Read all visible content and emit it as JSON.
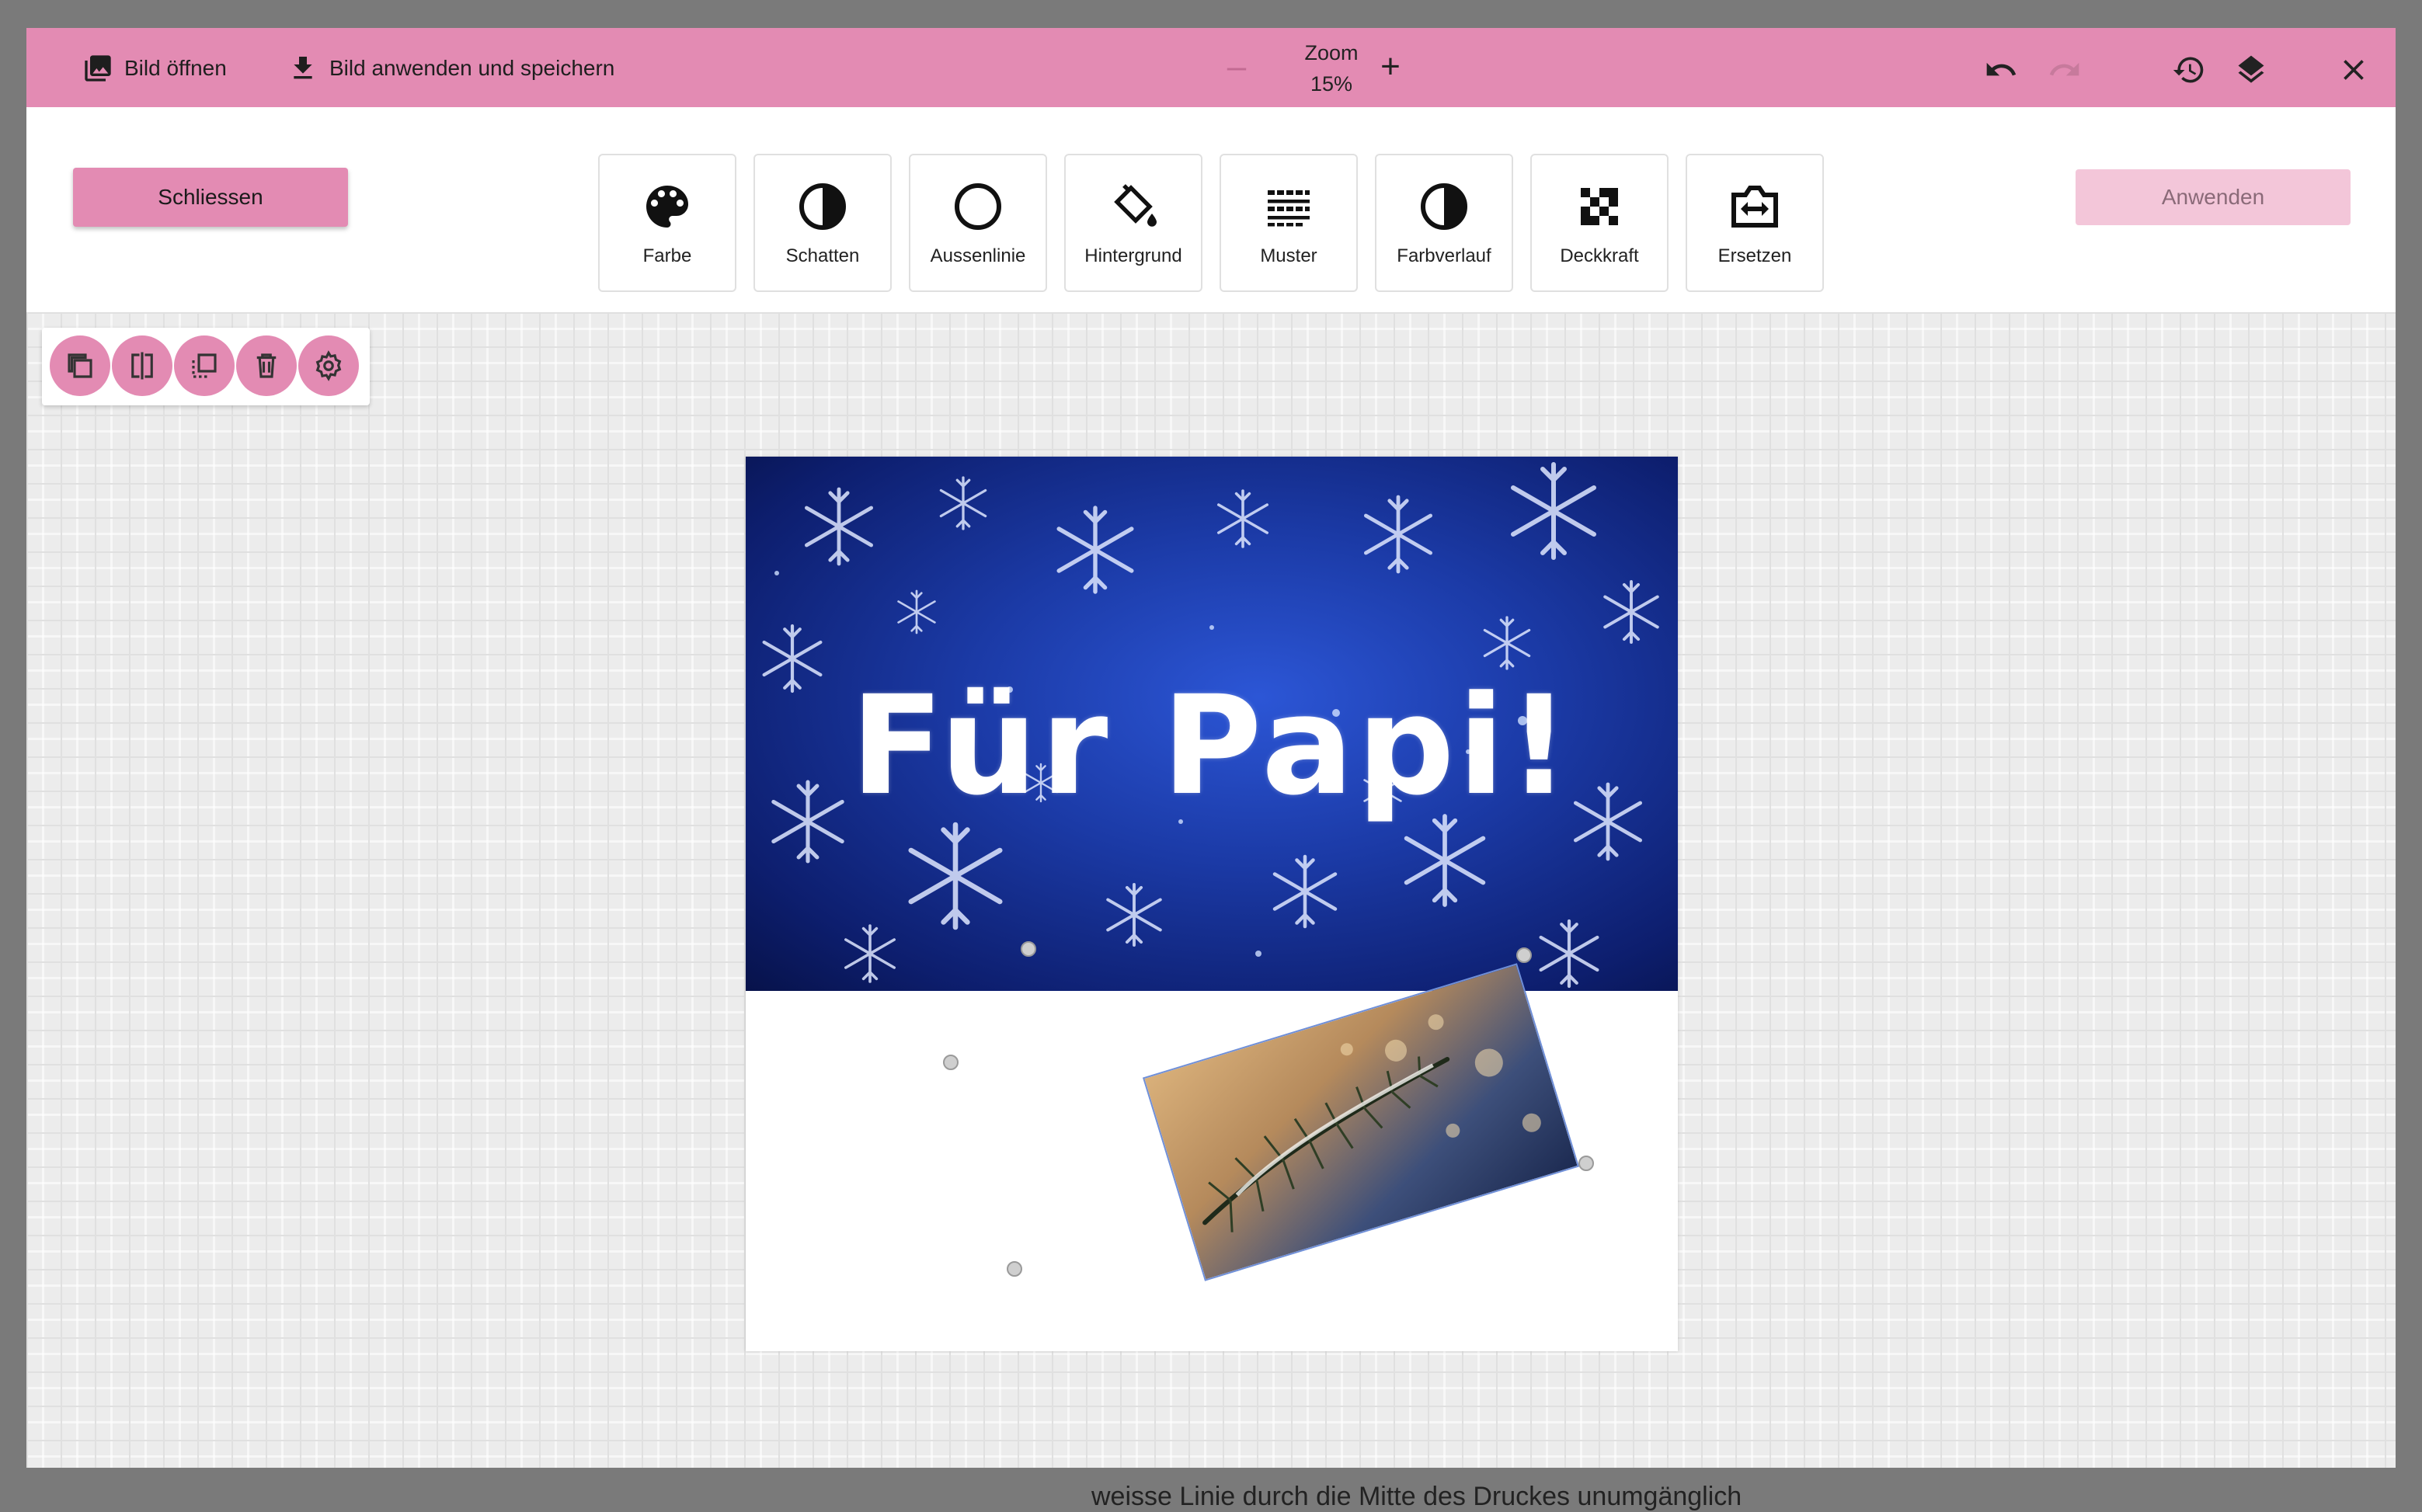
{
  "topbar": {
    "open_label": "Bild öffnen",
    "save_label": "Bild anwenden und speichern",
    "zoom_label": "Zoom",
    "zoom_value": "15%",
    "zoom_minus": "–",
    "zoom_plus": "+"
  },
  "actions": {
    "close_label": "Schliessen",
    "apply_label": "Anwenden"
  },
  "tools": [
    {
      "label": "Farbe",
      "icon": "palette-icon"
    },
    {
      "label": "Schatten",
      "icon": "contrast-icon"
    },
    {
      "label": "Aussenlinie",
      "icon": "circle-outline-icon"
    },
    {
      "label": "Hintergrund",
      "icon": "paint-bucket-icon"
    },
    {
      "label": "Muster",
      "icon": "pattern-icon"
    },
    {
      "label": "Farbverlauf",
      "icon": "gradient-icon"
    },
    {
      "label": "Deckkraft",
      "icon": "checkerboard-icon"
    },
    {
      "label": "Ersetzen",
      "icon": "swap-image-icon"
    }
  ],
  "context_toolbar": [
    "duplicate-icon",
    "flip-icon",
    "send-back-icon",
    "delete-icon",
    "settings-icon"
  ],
  "card": {
    "headline": "Für Papi!"
  },
  "backdrop_text": "weisse Linie durch die Mitte des Druckes unumgänglich",
  "colors": {
    "accent": "#e38bb3",
    "accent_disabled": "#f3c6d9",
    "photo_blue": "#1b3aa6"
  }
}
